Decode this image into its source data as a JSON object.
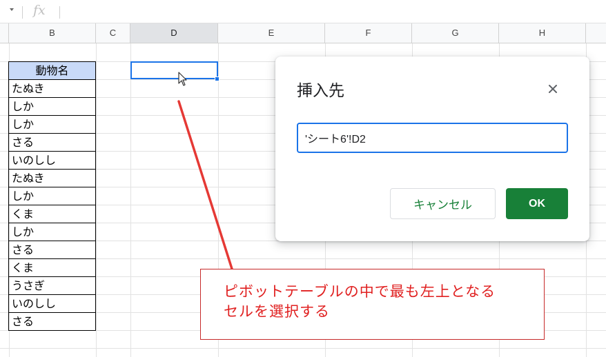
{
  "formula_bar": {
    "fx_label": "fx"
  },
  "columns": [
    "B",
    "C",
    "D",
    "E",
    "F",
    "G",
    "H"
  ],
  "animal_table": {
    "header": "動物名",
    "rows": [
      "たぬき",
      "しか",
      "しか",
      "さる",
      "いのしし",
      "たぬき",
      "しか",
      "くま",
      "しか",
      "さる",
      "くま",
      "うさぎ",
      "いのしし",
      "さる"
    ]
  },
  "dialog": {
    "title": "挿入先",
    "input_value": "'シート6'!D2",
    "cancel_label": "キャンセル",
    "ok_label": "OK"
  },
  "callout": {
    "line1": "ピボットテーブルの中で最も左上となる",
    "line2": "セルを選択する"
  },
  "colors": {
    "accent_blue": "#1a73e8",
    "ok_green": "#188038",
    "header_fill": "#c9daf8",
    "annotation_red": "#e02020"
  }
}
